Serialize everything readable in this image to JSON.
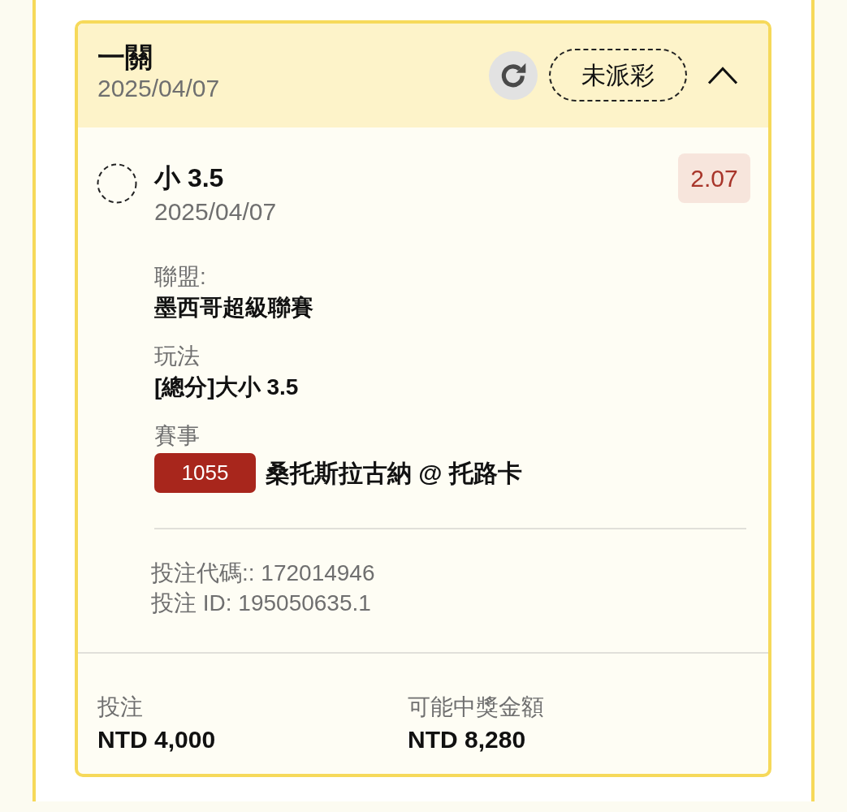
{
  "bet_card": {
    "header": {
      "title": "一關",
      "date": "2025/04/07",
      "status": "未派彩",
      "expanded": true
    },
    "selection": {
      "name": "小 3.5",
      "date": "2025/04/07",
      "odds": "2.07",
      "details": [
        {
          "label": "聯盟:",
          "value": "墨西哥超級聯賽"
        },
        {
          "label": "玩法",
          "value": "[總分]大小 3.5"
        },
        {
          "label": "賽事",
          "badge": "1055",
          "value": "桑托斯拉古納 @ 托路卡"
        }
      ],
      "codes": [
        "投注代碼:: 172014946",
        "投注 ID: 195050635.1"
      ]
    },
    "footer": [
      {
        "label": "投注",
        "value": "NTD 4,000"
      },
      {
        "label": "可能中獎金額",
        "value": "NTD 8,280"
      }
    ]
  }
}
